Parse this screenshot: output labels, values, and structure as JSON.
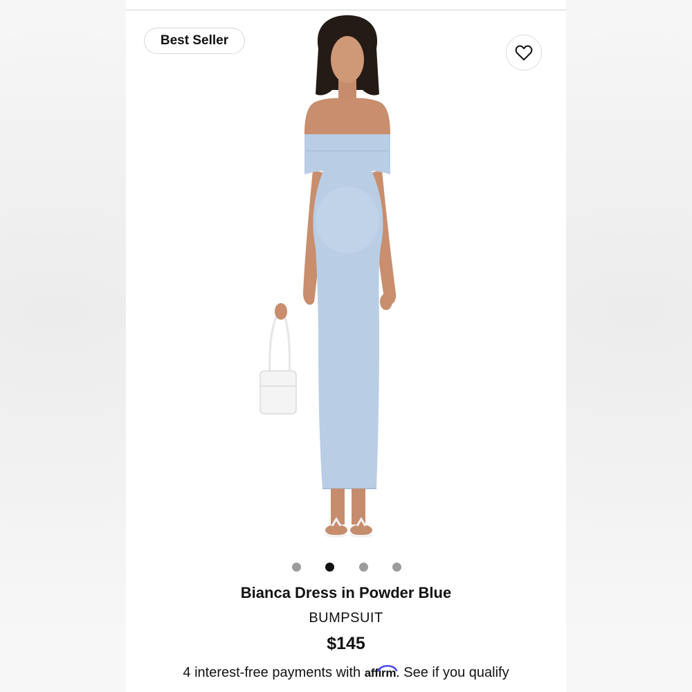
{
  "badge": {
    "label": "Best Seller"
  },
  "favorite": {
    "icon": "heart-icon"
  },
  "carousel": {
    "count": 4,
    "active_index": 1
  },
  "product": {
    "name": "Bianca Dress in Powder Blue",
    "brand": "BUMPSUIT",
    "price": "$145",
    "dress_color": "#b9cde5"
  },
  "financing": {
    "prefix": "4 interest-free payments with ",
    "provider": "affirm",
    "suffix": ". See if you qualify",
    "brand_color": "#4a4af4"
  }
}
